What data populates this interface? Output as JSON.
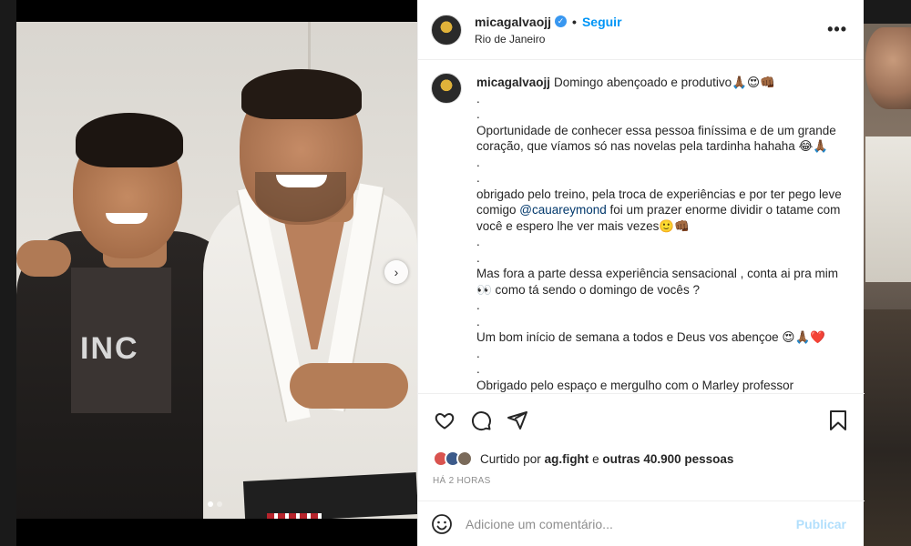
{
  "post": {
    "username": "micagalvaojj",
    "separator": "•",
    "follow_label": "Seguir",
    "location": "Rio de Janeiro",
    "more_label": "•••",
    "verified_icon": "verified-badge-icon",
    "shirt_text": "INC",
    "carousel_next_glyph": "›"
  },
  "caption": {
    "username": "micagalvaojj",
    "lines": {
      "l1": "Domingo abençoado e produtivo🙏🏾😍👊🏾",
      "l2": ".",
      "l3": ".",
      "l4": "Oportunidade de conhecer essa pessoa finíssima e de um grande coração, que víamos só nas novelas pela tardinha hahaha 😂🙏🏾",
      "l5": ".",
      "l6": ".",
      "l7a": "obrigado pelo treino, pela troca de experiências e por ter pego leve comigo ",
      "mention": "@cauareymond",
      "l7b": " foi um prazer enorme dividir o tatame com você e espero lhe ver mais vezes🙂👊🏾",
      "l8": ".",
      "l9": ".",
      "l10": "Mas fora a parte dessa experiência sensacional , conta ai pra mim 👀 como tá sendo o domingo de vocês ?",
      "l11": ".",
      "l12": ".",
      "l13": "Um bom início de semana a todos e Deus vos abençoe 😍🙏🏾❤️",
      "l14": ".",
      "l15": ".",
      "l16": "Obrigado pelo espaço e mergulho com o Marley professor"
    }
  },
  "actions": {
    "like_icon": "heart-icon",
    "comment_icon": "comment-icon",
    "share_icon": "share-icon",
    "save_icon": "bookmark-icon",
    "liked_by_prefix": "Curtido por",
    "liked_by_user": "ag.fight",
    "liked_by_and": "e",
    "liked_by_others": "outras 40.900 pessoas",
    "time_ago": "HÁ 2 HORAS"
  },
  "comment_box": {
    "placeholder": "Adicione um comentário...",
    "publish_label": "Publicar",
    "emoji_icon": "smiley-icon"
  },
  "colors": {
    "accent": "#0095f6",
    "publish_disabled": "#b2dffc",
    "like_red": "#ed4956"
  }
}
